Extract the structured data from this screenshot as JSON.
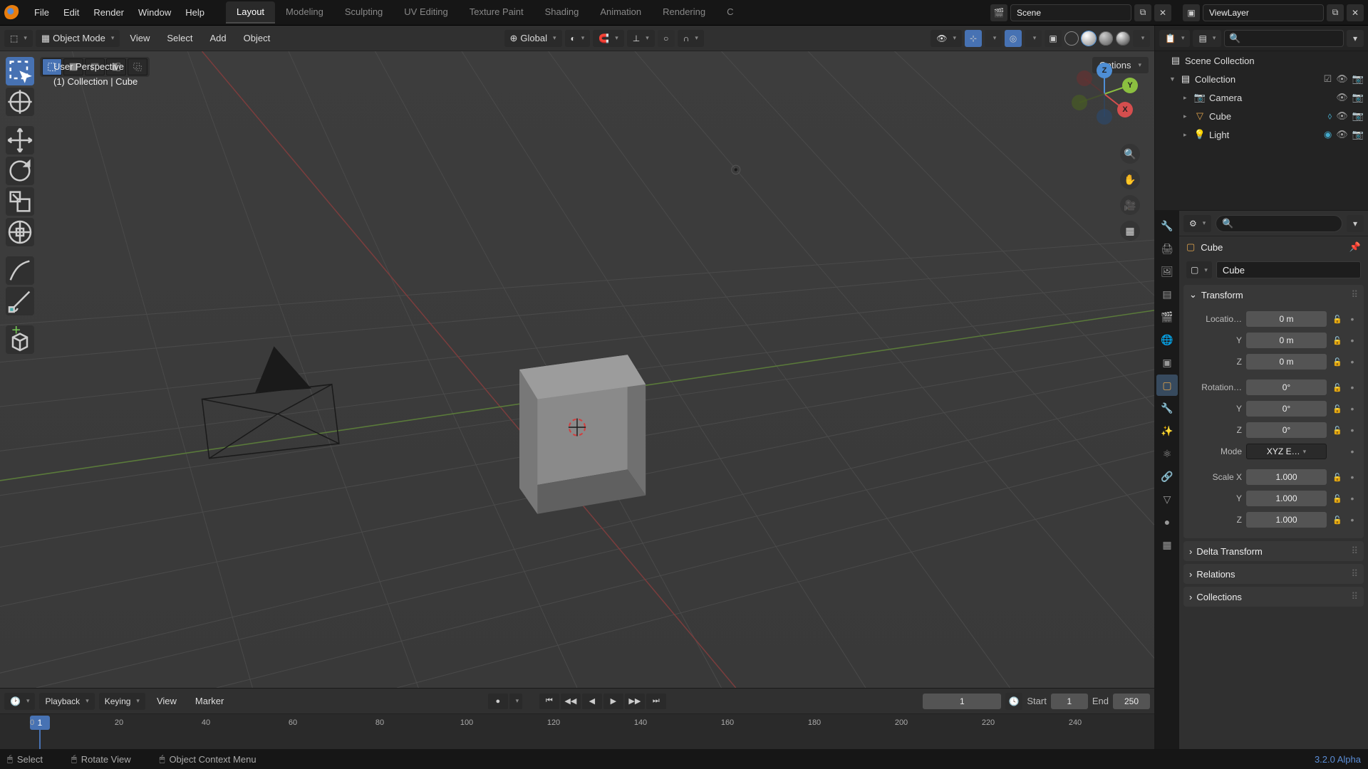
{
  "topbar": {
    "menus": [
      "File",
      "Edit",
      "Render",
      "Window",
      "Help"
    ],
    "workspaces": [
      "Layout",
      "Modeling",
      "Sculpting",
      "UV Editing",
      "Texture Paint",
      "Shading",
      "Animation",
      "Rendering",
      "C"
    ],
    "active_workspace": "Layout",
    "scene_label": "Scene",
    "viewlayer_label": "ViewLayer"
  },
  "viewport_header": {
    "mode": "Object Mode",
    "menus": [
      "View",
      "Select",
      "Add",
      "Object"
    ],
    "orientation": "Global",
    "options_label": "Options"
  },
  "viewport_info": {
    "line1": "User Perspective",
    "line2": "(1) Collection | Cube"
  },
  "timeline": {
    "dropdowns": [
      "Playback",
      "Keying"
    ],
    "menus": [
      "View",
      "Marker"
    ],
    "current_frame": "1",
    "start_label": "Start",
    "start_val": "1",
    "end_label": "End",
    "end_val": "250",
    "ticks": [
      "0",
      "20",
      "40",
      "60",
      "80",
      "100",
      "120",
      "140",
      "160",
      "180",
      "200",
      "220",
      "240"
    ]
  },
  "status": {
    "select": "Select",
    "rotate": "Rotate View",
    "context": "Object Context Menu",
    "version": "3.2.0 Alpha"
  },
  "outliner": {
    "root": "Scene Collection",
    "collection": "Collection",
    "items": [
      {
        "name": "Camera",
        "icon": "📷",
        "color": "#e0a44c"
      },
      {
        "name": "Cube",
        "icon": "▽",
        "color": "#e0a44c"
      },
      {
        "name": "Light",
        "icon": "💡",
        "color": "#e0a44c"
      }
    ]
  },
  "properties": {
    "breadcrumb": "Cube",
    "name_field": "Cube",
    "transform_label": "Transform",
    "loc": {
      "label": "Locatio…",
      "x": "0 m",
      "y": "0 m",
      "z": "0 m",
      "yl": "Y",
      "zl": "Z"
    },
    "rot": {
      "label": "Rotation…",
      "x": "0°",
      "y": "0°",
      "z": "0°",
      "yl": "Y",
      "zl": "Z"
    },
    "mode": {
      "label": "Mode",
      "val": "XYZ E…"
    },
    "scale": {
      "label": "Scale X",
      "x": "1.000",
      "y": "1.000",
      "z": "1.000",
      "yl": "Y",
      "zl": "Z"
    },
    "panels": [
      "Delta Transform",
      "Relations",
      "Collections"
    ]
  }
}
